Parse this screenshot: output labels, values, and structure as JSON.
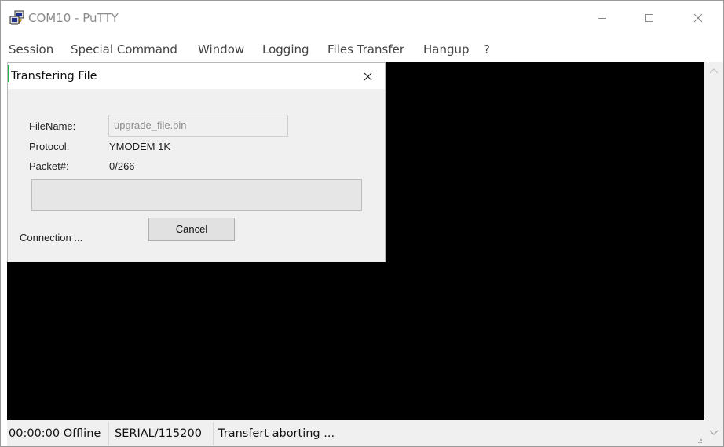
{
  "window": {
    "title": "COM10 - PuTTY"
  },
  "menu": [
    "Session",
    "Special Command",
    "Window",
    "Logging",
    "Files Transfer",
    "Hangup",
    "?"
  ],
  "dialog": {
    "title": "Transfering File",
    "filename_label": "FileName:",
    "filename_value": "upgrade_file.bin",
    "protocol_label": "Protocol:",
    "protocol_value": "YMODEM 1K",
    "packet_label": "Packet#:",
    "packet_value": "0/266",
    "progress": 0,
    "status": "Connection ...",
    "cancel_label": "Cancel"
  },
  "statusbar": {
    "time_status": "00:00:00 Offline",
    "port": "SERIAL/115200",
    "message": "Transfert aborting ..."
  },
  "colors": {
    "terminal_bg": "#000000",
    "progress_fill": "#06b025"
  },
  "icons": [
    "putty-icon",
    "minimize-icon",
    "maximize-icon",
    "close-icon",
    "scroll-up-icon",
    "scroll-down-icon",
    "resize-grip-icon"
  ]
}
